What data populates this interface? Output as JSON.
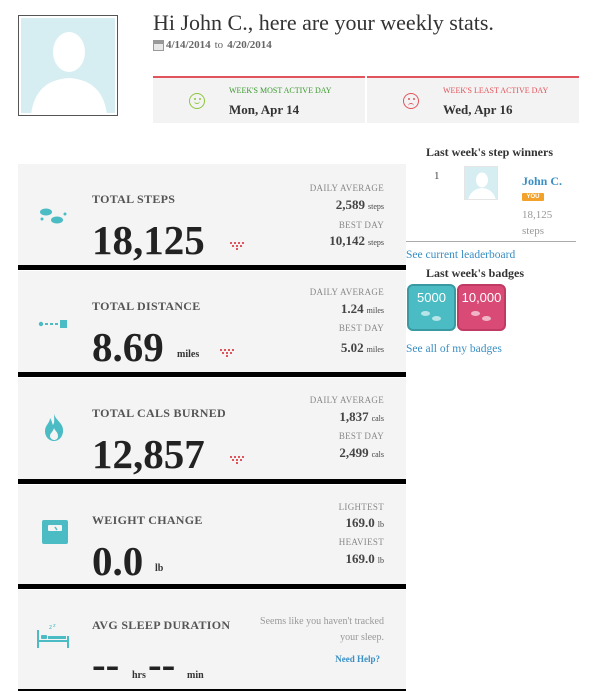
{
  "header": {
    "greeting": "Hi John C., here are your weekly stats.",
    "date_from": "4/14/2014",
    "date_to_word": "to",
    "date_to": "4/20/2014"
  },
  "days": {
    "most_label": "WEEK'S MOST ACTIVE DAY",
    "most_value": "Mon, Apr 14",
    "least_label": "WEEK'S LEAST ACTIVE DAY",
    "least_value": "Wed, Apr 16"
  },
  "stats": {
    "steps": {
      "title": "TOTAL STEPS",
      "value": "18,125",
      "avg_label": "DAILY AVERAGE",
      "avg_value": "2,589",
      "avg_unit": "steps",
      "best_label": "BEST DAY",
      "best_value": "10,142",
      "best_unit": "steps"
    },
    "distance": {
      "title": "TOTAL DISTANCE",
      "value": "8.69",
      "unit": "miles",
      "avg_label": "DAILY AVERAGE",
      "avg_value": "1.24",
      "avg_unit": "miles",
      "best_label": "BEST DAY",
      "best_value": "5.02",
      "best_unit": "miles"
    },
    "cals": {
      "title": "TOTAL CALS BURNED",
      "value": "12,857",
      "avg_label": "DAILY AVERAGE",
      "avg_value": "1,837",
      "avg_unit": "cals",
      "best_label": "BEST DAY",
      "best_value": "2,499",
      "best_unit": "cals"
    },
    "weight": {
      "title": "WEIGHT CHANGE",
      "value": "0.0",
      "unit": "lb",
      "lightest_label": "LIGHTEST",
      "lightest_value": "169.0",
      "lightest_unit": "lb",
      "heaviest_label": "HEAVIEST",
      "heaviest_value": "169.0",
      "heaviest_unit": "lb"
    },
    "sleep": {
      "title": "AVG SLEEP DURATION",
      "hrs_value": "--",
      "hrs_unit": "hrs",
      "min_value": "--",
      "min_unit": "min",
      "message": "Seems like you haven't tracked your sleep.",
      "help": "Need Help?"
    }
  },
  "sidebar": {
    "winners_title": "Last week's step winners",
    "winner": {
      "rank": "1",
      "name": "John C.",
      "badge": "YOU",
      "steps": "18,125",
      "steps_unit": "steps"
    },
    "leaderboard_link": "See current leaderboard",
    "badges_title": "Last week's badges",
    "badges": [
      {
        "label": "5000",
        "color": "#4bbcc4"
      },
      {
        "label": "10,000",
        "color": "#d94a76"
      }
    ],
    "badges_link": "See all of my badges"
  },
  "colors": {
    "teal_icon": "#4bbcc4",
    "link": "#3a8fc4",
    "accent_red": "#e2545b",
    "accent_green": "#8dc63f"
  },
  "icons": [
    "footprints-icon",
    "route-icon",
    "flame-icon",
    "scale-icon",
    "sleep-bed-icon",
    "smiley-icon",
    "frown-icon",
    "calendar-icon",
    "bar-chart-icon"
  ]
}
